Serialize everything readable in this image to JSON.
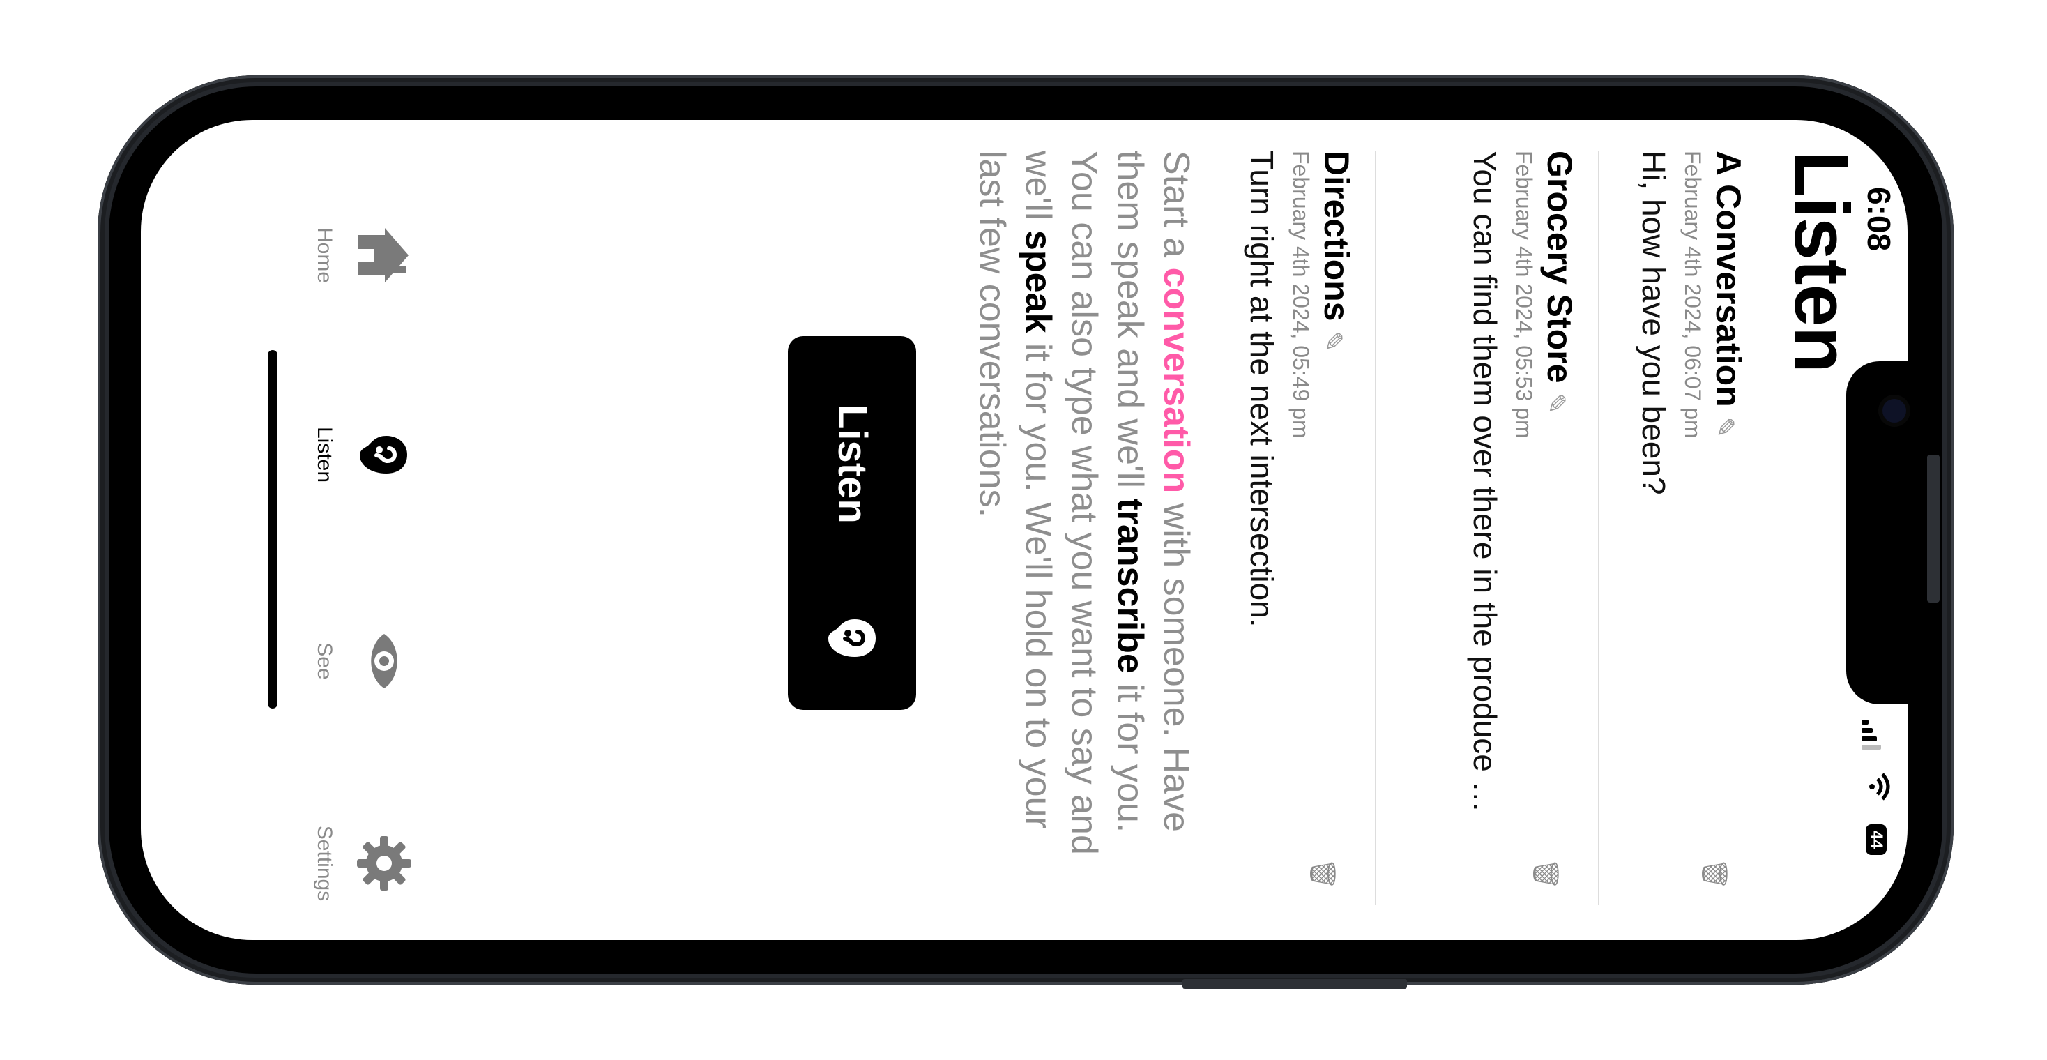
{
  "status_bar": {
    "time": "6:08",
    "battery": "44",
    "signal_icon": "cellular-signal-icon",
    "wifi_icon": "wifi-icon"
  },
  "page": {
    "title": "Listen"
  },
  "conversations": [
    {
      "title": "A Conversation",
      "date": "February 4th 2024, 06:07 pm",
      "text": "Hi, how have you been?"
    },
    {
      "title": "Grocery Store",
      "date": "February 4th 2024, 05:53 pm",
      "text": "You can find them over there in the produce se..."
    },
    {
      "title": "Directions",
      "date": "February 4th 2024, 05:49 pm",
      "text": "Turn right at the next intersection."
    }
  ],
  "description": {
    "part1": "Start a ",
    "highlight": "conversation",
    "part2": " with someone. Have them speak and we'll ",
    "bold1": "transcribe",
    "part3": " it for you. You can also type what you want to say and we'll ",
    "bold2": "speak",
    "part4": " it for you. We'll hold on to your last few conversations."
  },
  "listen_button": {
    "label": "Listen"
  },
  "tabs": [
    {
      "label": "Home",
      "icon": "home-icon",
      "active": false
    },
    {
      "label": "Listen",
      "icon": "ear-icon",
      "active": true
    },
    {
      "label": "See",
      "icon": "eye-icon",
      "active": false
    },
    {
      "label": "Settings",
      "icon": "gear-icon",
      "active": false
    }
  ],
  "colors": {
    "accent_pink": "#ff5aa8",
    "text_gray": "#8e8e8e",
    "button_black": "#000000"
  }
}
